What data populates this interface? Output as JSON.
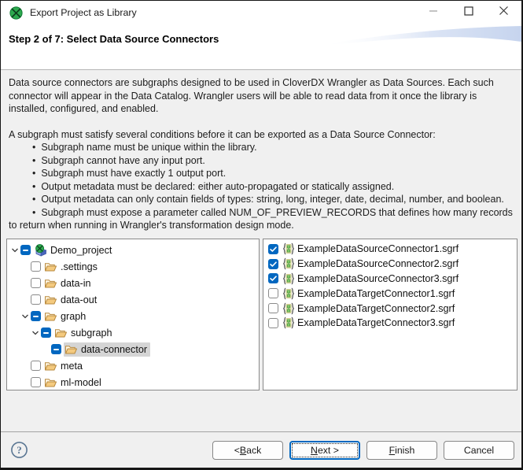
{
  "window": {
    "title": "Export Project as Library"
  },
  "titlebar": {
    "icon": "cloverdx-logo",
    "controls": [
      {
        "name": "minimize",
        "glyph": "–"
      },
      {
        "name": "maximize",
        "glyph": "□"
      },
      {
        "name": "close",
        "glyph": "✕"
      }
    ]
  },
  "header": {
    "title": "Step 2 of 7: Select Data Source Connectors"
  },
  "body": {
    "intro": "Data source connectors are subgraphs designed to be used in CloverDX Wrangler as Data Sources. Each such connector will appear in the Data Catalog. Wrangler users will be able to read data from it once the library is installed, configured, and enabled.",
    "conditions_lead": "A subgraph must satisfy several conditions before it can be exported as a Data Source Connector:",
    "bullet_char": "•",
    "bullets": [
      "Subgraph name must be unique within the library.",
      "Subgraph cannot have any input port.",
      "Subgraph must have exactly 1 output port.",
      "Output metadata must be declared: either auto-propagated or statically assigned.",
      "Output metadata can only contain fields of types: string, long, integer, date, decimal, number, and boolean.",
      "Subgraph must expose a parameter called NUM_OF_PREVIEW_RECORDS that defines how many records to return when running in Wrangler's transformation design mode."
    ]
  },
  "tree": {
    "items": [
      {
        "label": "Demo_project",
        "level": 0,
        "expanded": true,
        "state": "indeterminate",
        "icon": "project",
        "selected": false
      },
      {
        "label": ".settings",
        "level": 1,
        "expanded": false,
        "state": "unchecked",
        "icon": "folder",
        "selected": false
      },
      {
        "label": "data-in",
        "level": 1,
        "expanded": false,
        "state": "unchecked",
        "icon": "folder",
        "selected": false
      },
      {
        "label": "data-out",
        "level": 1,
        "expanded": false,
        "state": "unchecked",
        "icon": "folder",
        "selected": false
      },
      {
        "label": "graph",
        "level": 1,
        "expanded": true,
        "state": "indeterminate",
        "icon": "folder",
        "selected": false
      },
      {
        "label": "subgraph",
        "level": 2,
        "expanded": true,
        "state": "indeterminate",
        "icon": "folder",
        "selected": false
      },
      {
        "label": "data-connector",
        "level": 3,
        "expanded": false,
        "state": "indeterminate",
        "icon": "folder",
        "selected": true
      },
      {
        "label": "meta",
        "level": 1,
        "expanded": false,
        "state": "unchecked",
        "icon": "folder",
        "selected": false
      },
      {
        "label": "ml-model",
        "level": 1,
        "expanded": false,
        "state": "unchecked",
        "icon": "folder",
        "selected": false
      }
    ]
  },
  "files": {
    "items": [
      {
        "label": "ExampleDataSourceConnector1.sgrf",
        "checked": true
      },
      {
        "label": "ExampleDataSourceConnector2.sgrf",
        "checked": true
      },
      {
        "label": "ExampleDataSourceConnector3.sgrf",
        "checked": true
      },
      {
        "label": "ExampleDataTargetConnector1.sgrf",
        "checked": false
      },
      {
        "label": "ExampleDataTargetConnector2.sgrf",
        "checked": false
      },
      {
        "label": "ExampleDataTargetConnector3.sgrf",
        "checked": false
      }
    ]
  },
  "footer": {
    "help_char": "?",
    "buttons": [
      {
        "name": "back",
        "pre": "< ",
        "mn": "B",
        "post": "ack"
      },
      {
        "name": "next",
        "pre": "",
        "mn": "N",
        "post": "ext >"
      },
      {
        "name": "finish",
        "pre": "",
        "mn": "F",
        "post": "inish"
      },
      {
        "name": "cancel",
        "pre": "",
        "mn": "",
        "post": "Cancel"
      }
    ]
  },
  "colors": {
    "accent": "#0067c0",
    "selection_bg": "#d5d5d5",
    "content_bg": "#f0f0f0"
  }
}
